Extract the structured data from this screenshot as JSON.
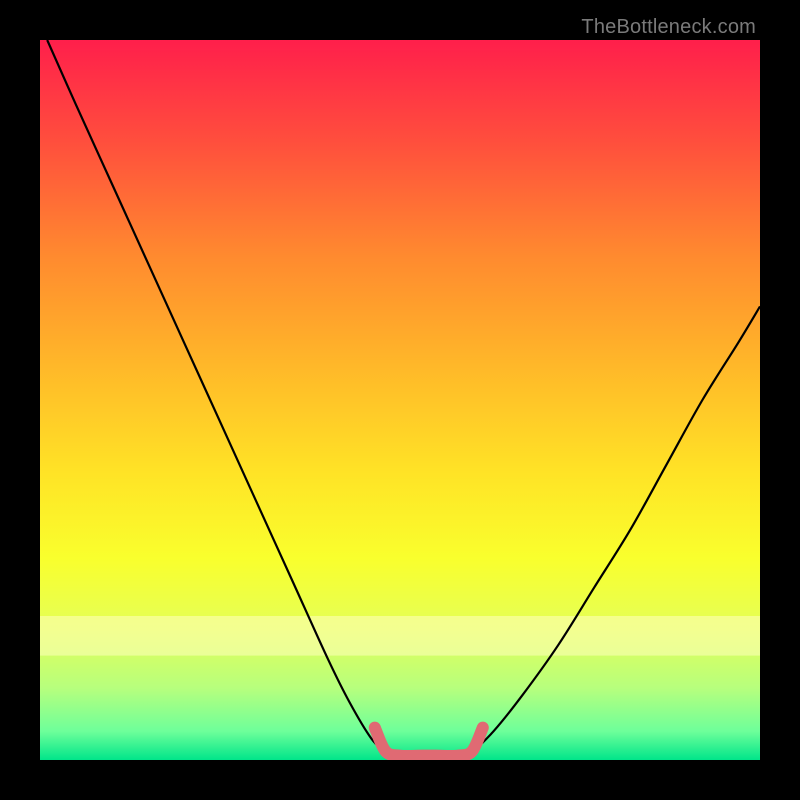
{
  "watermark": "TheBottleneck.com",
  "chart_data": {
    "type": "line",
    "title": "",
    "xlabel": "",
    "ylabel": "",
    "xlim": [
      0,
      100
    ],
    "ylim": [
      0,
      100
    ],
    "grid": false,
    "legend": false,
    "gradient": {
      "stops": [
        {
          "offset": 0.0,
          "color": "#ff1f4b"
        },
        {
          "offset": 0.14,
          "color": "#ff4e3d"
        },
        {
          "offset": 0.3,
          "color": "#ff8a2f"
        },
        {
          "offset": 0.45,
          "color": "#ffb729"
        },
        {
          "offset": 0.6,
          "color": "#ffe326"
        },
        {
          "offset": 0.72,
          "color": "#f9ff2d"
        },
        {
          "offset": 0.82,
          "color": "#e4ff58"
        },
        {
          "offset": 0.9,
          "color": "#b7ff7d"
        },
        {
          "offset": 0.96,
          "color": "#6eff9a"
        },
        {
          "offset": 1.0,
          "color": "#00e58a"
        }
      ]
    },
    "series": [
      {
        "name": "left-branch",
        "color": "#000000",
        "stroke_width": 2.2,
        "x": [
          1,
          5,
          10,
          15,
          20,
          25,
          30,
          35,
          40,
          43,
          46,
          48
        ],
        "y": [
          100,
          91,
          80,
          69,
          58,
          47,
          36,
          25,
          14,
          8,
          3,
          1
        ]
      },
      {
        "name": "valley-highlight",
        "color": "#e06a73",
        "stroke_width": 12,
        "linecap": "round",
        "x": [
          46.5,
          48,
          50,
          53,
          55,
          58,
          60,
          61.5
        ],
        "y": [
          4.5,
          1.2,
          0.6,
          0.6,
          0.6,
          0.6,
          1.2,
          4.5
        ]
      },
      {
        "name": "right-branch",
        "color": "#000000",
        "stroke_width": 2.2,
        "x": [
          60,
          63,
          67,
          72,
          77,
          82,
          87,
          92,
          97,
          100
        ],
        "y": [
          1,
          4,
          9,
          16,
          24,
          32,
          41,
          50,
          58,
          63
        ]
      }
    ]
  }
}
